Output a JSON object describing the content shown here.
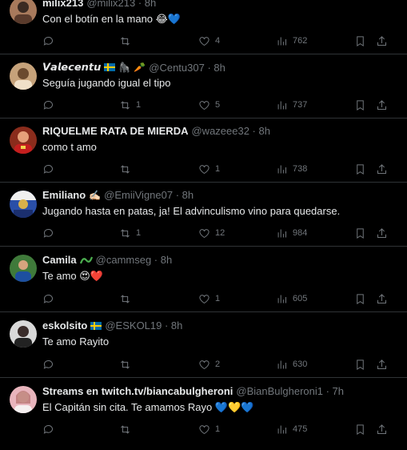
{
  "tweets": [
    {
      "name": "milix213",
      "handle": "@milix213 · 8h",
      "text": "Con el botín en la mano 😂💙",
      "replies": "",
      "retweets": "",
      "likes": "4",
      "views": "762",
      "avatar_color": "#a87a5c"
    },
    {
      "name": "𝙑𝙖𝙡𝙚𝙘𝙚𝙣𝙩𝙪",
      "handle": "@Centu307 · 8h",
      "text": "Seguía jugando igual el tipo",
      "replies": "",
      "retweets": "1",
      "likes": "5",
      "views": "737",
      "avatar_color": "#c6a27a"
    },
    {
      "name": "RIQUELME RATA DE MIERDA",
      "handle": "@wazeee32 · 8h",
      "text": "como t amo",
      "replies": "",
      "retweets": "",
      "likes": "1",
      "views": "738",
      "avatar_color": "#8a2c1c"
    },
    {
      "name": "Emiliano",
      "handle": "@EmiiVigne07 · 8h",
      "text": "Jugando hasta en patas, ja! El advinculismo vino para quedarse.",
      "replies": "",
      "retweets": "1",
      "likes": "12",
      "views": "984",
      "avatar_color": "#2a4fa8"
    },
    {
      "name": "Camila",
      "handle": "@cammseg · 8h",
      "text": "Te amo 😍❤️",
      "replies": "",
      "retweets": "",
      "likes": "1",
      "views": "605",
      "avatar_color": "#3f7a3a"
    },
    {
      "name": "eskolsito",
      "handle": "@ESKOL19 · 8h",
      "text": "Te amo Rayito",
      "replies": "",
      "retweets": "",
      "likes": "2",
      "views": "630",
      "avatar_color": "#d9d9d9"
    },
    {
      "name": "Streams en twitch.tv/biancabulgheroni",
      "handle": "@BianBulgheroni1 · 7h",
      "text": "El Capitán sin cita. Te amamos Rayo 💙💛💙",
      "replies": "",
      "retweets": "",
      "likes": "1",
      "views": "475",
      "avatar_color": "#e8b4bc"
    }
  ]
}
